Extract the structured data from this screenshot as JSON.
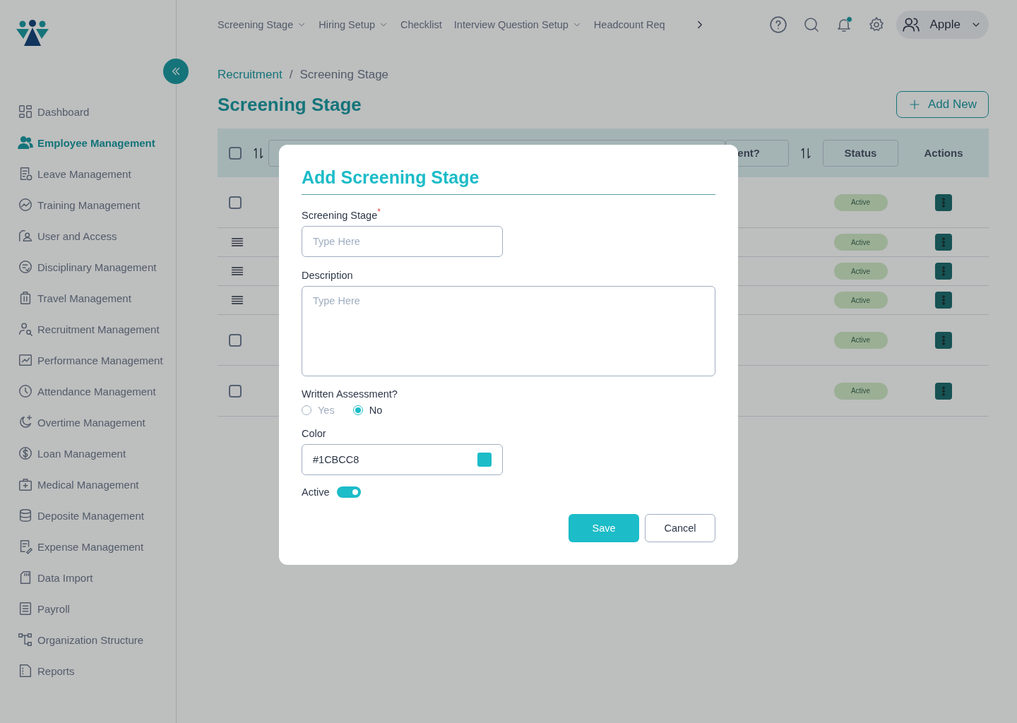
{
  "top_nav": [
    {
      "label": "Screening Stage",
      "dropdown": true
    },
    {
      "label": "Hiring Setup",
      "dropdown": true
    },
    {
      "label": "Checklist",
      "dropdown": false
    },
    {
      "label": "Interview Question Setup",
      "dropdown": true
    },
    {
      "label": "Headcount Req",
      "dropdown": false
    }
  ],
  "notifications": {
    "unread": true
  },
  "user": {
    "name": "Apple"
  },
  "sidebar": {
    "items": [
      {
        "label": "Dashboard",
        "selected": false
      },
      {
        "label": "Employee Management",
        "selected": true
      },
      {
        "label": "Leave Management",
        "selected": false
      },
      {
        "label": "Training Management",
        "selected": false
      },
      {
        "label": "User and Access",
        "selected": false
      },
      {
        "label": "Disciplinary Management",
        "selected": false
      },
      {
        "label": "Travel Management",
        "selected": false
      },
      {
        "label": "Recruitment Management",
        "selected": false
      },
      {
        "label": "Performance Management",
        "selected": false
      },
      {
        "label": "Attendance Management",
        "selected": false
      },
      {
        "label": "Overtime Management",
        "selected": false
      },
      {
        "label": "Loan Management",
        "selected": false
      },
      {
        "label": "Medical Management",
        "selected": false
      },
      {
        "label": "Deposite Management",
        "selected": false
      },
      {
        "label": "Expense Management",
        "selected": false
      },
      {
        "label": "Data Import",
        "selected": false
      },
      {
        "label": "Payroll",
        "selected": false
      },
      {
        "label": "Organization Structure",
        "selected": false
      },
      {
        "label": "Reports",
        "selected": false
      }
    ]
  },
  "breadcrumb": [
    "Recruitment",
    "Screening Stage"
  ],
  "breadcrumb_separator": "/",
  "page_title": "Screening Stage",
  "add_button": "Add New",
  "table": {
    "select_all_checked": false,
    "columns": [
      "ent?",
      "Status",
      "Actions"
    ],
    "rows": [
      {
        "kind": "checkbox",
        "checked": false,
        "status": "Active"
      },
      {
        "kind": "handle",
        "status": "Active"
      },
      {
        "kind": "handle",
        "status": "Active"
      },
      {
        "kind": "handle",
        "status": "Active"
      },
      {
        "kind": "checkbox",
        "checked": false,
        "status": "Active"
      },
      {
        "kind": "checkbox",
        "checked": false,
        "status": "Active"
      }
    ]
  },
  "modal": {
    "title": "Add Screening Stage",
    "stage": {
      "label": "Screening Stage",
      "required_mark": "*",
      "placeholder": "Type Here"
    },
    "description": {
      "label": "Description",
      "placeholder": "Type Here"
    },
    "written_assessment": {
      "label": "Written Assessment?",
      "options": [
        {
          "label": "Yes",
          "selected": false
        },
        {
          "label": "No",
          "selected": true
        }
      ]
    },
    "color": {
      "label": "Color",
      "value": "#1CBCC8",
      "color": "#1cbcc8"
    },
    "active": {
      "label": "Active",
      "on": true
    },
    "buttons": {
      "save": "Save",
      "cancel": "Cancel"
    }
  }
}
